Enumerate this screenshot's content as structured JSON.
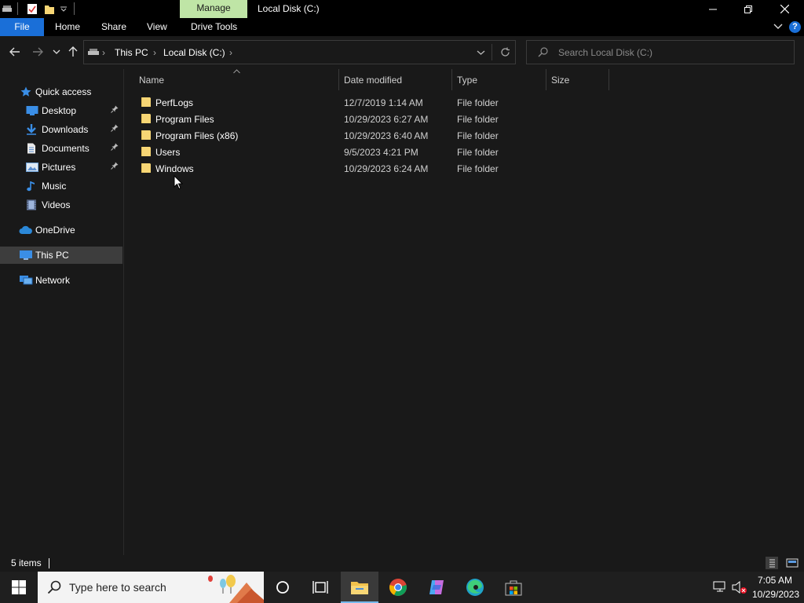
{
  "window": {
    "title": "Local Disk (C:)",
    "context_tab": "Manage"
  },
  "ribbon": {
    "tabs": [
      "File",
      "Home",
      "Share",
      "View",
      "Drive Tools"
    ]
  },
  "address": {
    "crumbs": [
      "This PC",
      "Local Disk (C:)"
    ]
  },
  "search": {
    "placeholder": "Search Local Disk (C:)"
  },
  "nav": {
    "quick_access": "Quick access",
    "items": [
      {
        "label": "Desktop",
        "pinned": true,
        "icon": "desktop-icon"
      },
      {
        "label": "Downloads",
        "pinned": true,
        "icon": "download-arrow-icon"
      },
      {
        "label": "Documents",
        "pinned": true,
        "icon": "document-icon"
      },
      {
        "label": "Pictures",
        "pinned": true,
        "icon": "picture-icon"
      },
      {
        "label": "Music",
        "pinned": false,
        "icon": "music-note-icon"
      },
      {
        "label": "Videos",
        "pinned": false,
        "icon": "film-icon"
      }
    ],
    "onedrive": "OneDrive",
    "this_pc": "This PC",
    "network": "Network",
    "pin_glyph": "📌"
  },
  "columns": {
    "name": "Name",
    "date": "Date modified",
    "type": "Type",
    "size": "Size"
  },
  "files": [
    {
      "name": "PerfLogs",
      "date": "12/7/2019 1:14 AM",
      "type": "File folder"
    },
    {
      "name": "Program Files",
      "date": "10/29/2023 6:27 AM",
      "type": "File folder"
    },
    {
      "name": "Program Files (x86)",
      "date": "10/29/2023 6:40 AM",
      "type": "File folder"
    },
    {
      "name": "Users",
      "date": "9/5/2023 4:21 PM",
      "type": "File folder"
    },
    {
      "name": "Windows",
      "date": "10/29/2023 6:24 AM",
      "type": "File folder"
    }
  ],
  "status": {
    "count": "5 items"
  },
  "taskbar": {
    "search_placeholder": "Type here to search",
    "time": "7:05 AM",
    "date": "10/29/2023"
  },
  "colors": {
    "accent": "#1a6fd8",
    "manage_tab": "#bfe5a6",
    "folder": "#f7d675",
    "selection": "#3d3d3d"
  }
}
